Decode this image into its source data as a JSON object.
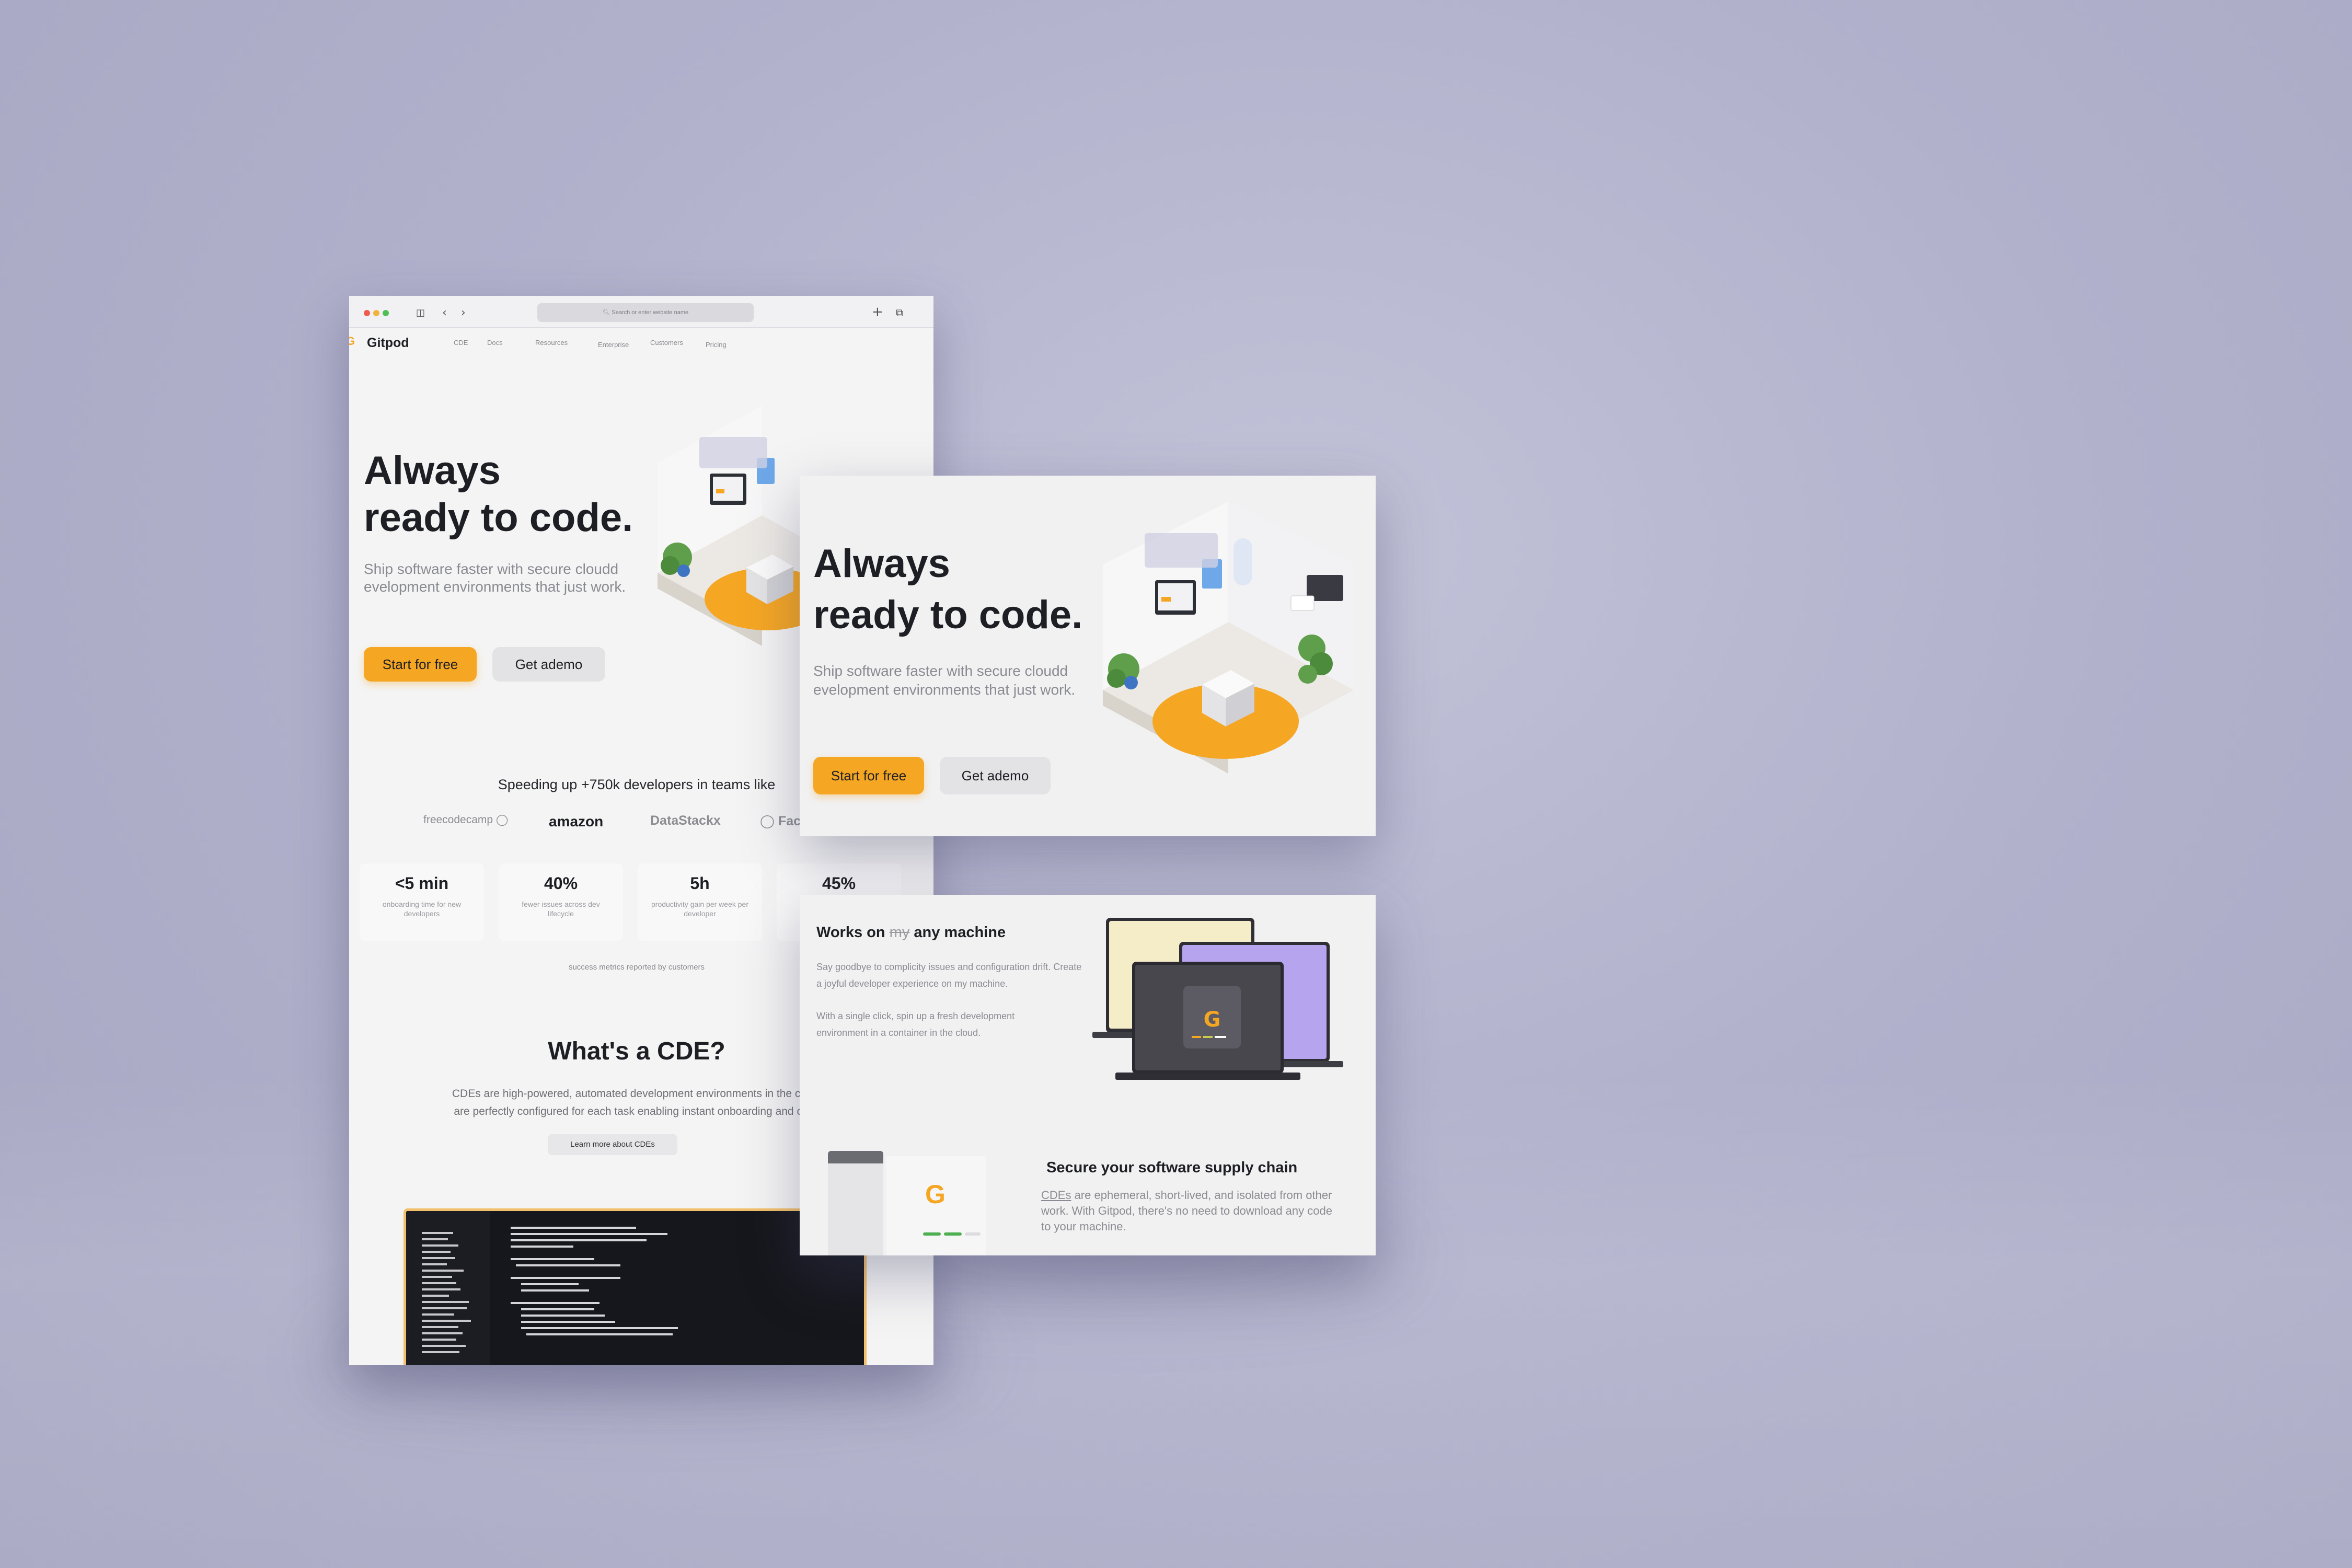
{
  "browser": {
    "url_placeholder": "Search or enter website name",
    "back_icon": "chevron-left-icon",
    "forward_icon": "chevron-right-icon",
    "sidebar_icon": "sidebar-icon",
    "new_tab_icon": "plus-icon",
    "tabs_icon": "tabs-icon"
  },
  "nav": {
    "brand": "Gitpod",
    "links": [
      "CDE",
      "Docs",
      "Resources",
      "Enterprise",
      "Customers",
      "Pricing"
    ]
  },
  "hero": {
    "title_line1": "Always",
    "title_line2": "ready to code.",
    "subtitle": "Ship software faster with secure cloudd evelopment environments that just work.",
    "cta_primary": "Start for free",
    "cta_secondary": "Get ademo"
  },
  "customers": {
    "heading": "Speeding up +750k developers in teams like",
    "logos": [
      "freecodecamp",
      "amazon",
      "DataStackx",
      "Fac"
    ]
  },
  "metrics": [
    {
      "value": "<5 min",
      "label": "onboarding time for new developers"
    },
    {
      "value": "40%",
      "label": "fewer issues across dev lifecycle"
    },
    {
      "value": "5h",
      "label": "productivity gain per week per developer"
    },
    {
      "value": "45%",
      "label": ""
    }
  ],
  "metrics_note": "success metrics reported by customers",
  "cde": {
    "title": "What's a CDE?",
    "body_line1": "CDEs are high-powered, automated development environments in the cloud",
    "body_line2": "are perfectly configured for each task enabling instant onboarding and colla",
    "learn_more": "Learn more about CDEs"
  },
  "feature_machine": {
    "title_prefix": "Works on",
    "title_strike": "my",
    "title_suffix": "any machine",
    "para1": "Say goodbye to complicity issues and configuration drift. Create a joyful developer experience on my machine.",
    "para2": "With a single click, spin up a fresh development environment in a container in the cloud."
  },
  "feature_secure": {
    "title": "Secure your software supply chain",
    "body_link": "CDEs",
    "body_rest": " are ephemeral, short-lived, and isolated from other work. With Gitpod, there's no need to download any code to your machine."
  },
  "colors": {
    "accent": "#f5a623",
    "background": "#b3b3cd",
    "laptop_cream": "#f5ecc8",
    "laptop_purple": "#b6a4ee",
    "laptop_dark": "#48474e"
  }
}
